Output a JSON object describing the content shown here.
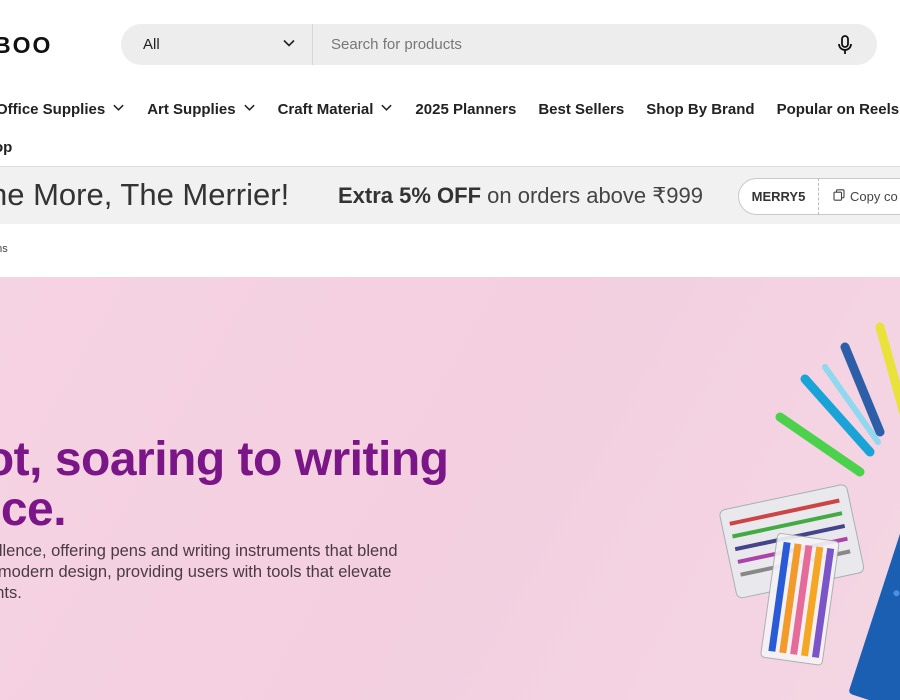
{
  "header": {
    "logo_text": "BOO",
    "search": {
      "category_value": "All",
      "placeholder": "Search for products"
    }
  },
  "nav": {
    "items": [
      {
        "label": "Office Supplies",
        "has_dropdown": true
      },
      {
        "label": "Art Supplies",
        "has_dropdown": true
      },
      {
        "label": "Craft Material",
        "has_dropdown": true
      },
      {
        "label": "2025 Planners",
        "has_dropdown": false
      },
      {
        "label": "Best Sellers",
        "has_dropdown": false
      },
      {
        "label": "Shop By Brand",
        "has_dropdown": false
      },
      {
        "label": "Popular on Reels",
        "has_dropdown": false
      }
    ],
    "second_row": "op"
  },
  "promo": {
    "title": "he More, The Merrier!",
    "offer_bold": "Extra 5% OFF",
    "offer_rest": " on orders above ₹999",
    "coupon_code": "MERRY5",
    "copy_label": "Copy co"
  },
  "breadcrumb": "ens",
  "hero": {
    "heading_line1": "lot, soaring to writing",
    "heading_line2": "nce.",
    "body_line1": "excellence, offering pens and writing instruments that blend",
    "body_line2": "with modern design, providing users with tools that elevate",
    "body_line3": "heights."
  },
  "colors": {
    "accent": "#7a1687",
    "hero_bg": "#f3cfe0",
    "search_bg": "#ededed",
    "promo_bg": "#f1f1f1"
  },
  "icons": [
    "chevron-down-icon",
    "microphone-icon",
    "copy-icon"
  ]
}
